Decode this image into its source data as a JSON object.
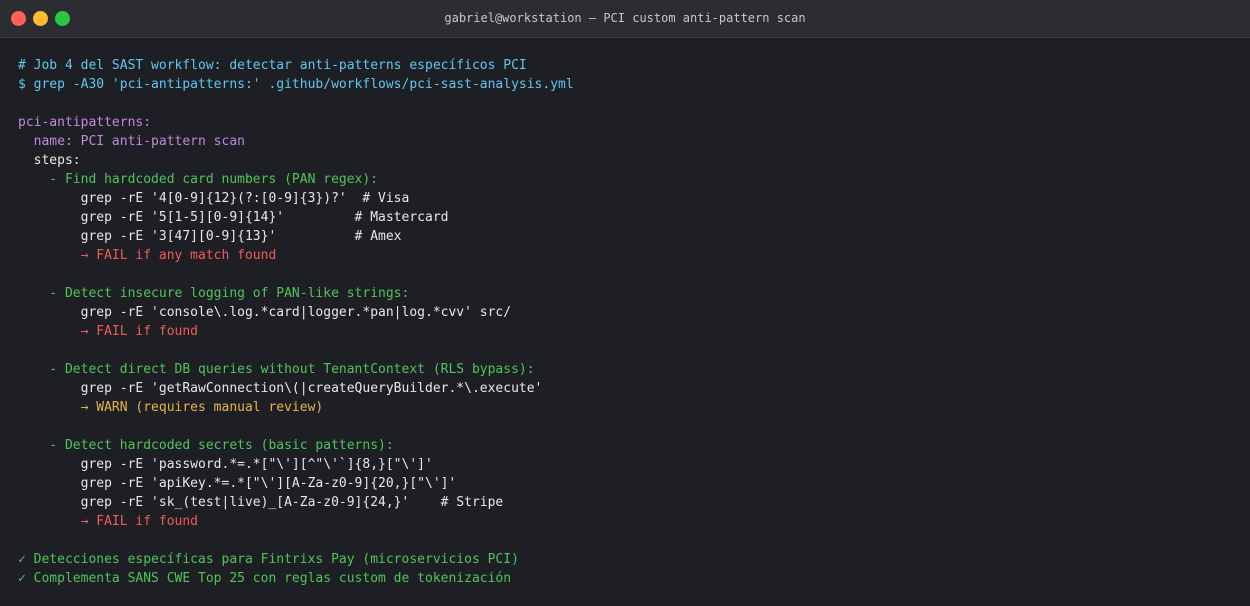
{
  "window": {
    "title": "gabriel@workstation — PCI custom anti-pattern scan"
  },
  "terminal": {
    "lines": [
      {
        "text": "# Job 4 del SAST workflow: detectar anti-patterns específicos PCI",
        "style": "comment"
      },
      {
        "text": "$ grep -A30 'pci-antipatterns:' .github/workflows/pci-sast-analysis.yml",
        "style": "command"
      },
      {
        "text": "",
        "style": "white"
      },
      {
        "text": "pci-antipatterns:",
        "style": "key"
      },
      {
        "text": "  name: PCI anti-pattern scan",
        "style": "key"
      },
      {
        "text": "  steps:",
        "style": "white"
      },
      {
        "text": "    - Find hardcoded card numbers (PAN regex):",
        "style": "step"
      },
      {
        "text": "        grep -rE '4[0-9]{12}(?:[0-9]{3})?'  # Visa",
        "style": "white"
      },
      {
        "text": "        grep -rE '5[1-5][0-9]{14}'         # Mastercard",
        "style": "white"
      },
      {
        "text": "        grep -rE '3[47][0-9]{13}'          # Amex",
        "style": "white"
      },
      {
        "text": "        → FAIL if any match found",
        "style": "fail"
      },
      {
        "text": "",
        "style": "white"
      },
      {
        "text": "    - Detect insecure logging of PAN-like strings:",
        "style": "step"
      },
      {
        "text": "        grep -rE 'console\\.log.*card|logger.*pan|log.*cvv' src/",
        "style": "white"
      },
      {
        "text": "        → FAIL if found",
        "style": "fail"
      },
      {
        "text": "",
        "style": "white"
      },
      {
        "text": "    - Detect direct DB queries without TenantContext (RLS bypass):",
        "style": "step"
      },
      {
        "text": "        grep -rE 'getRawConnection\\(|createQueryBuilder.*\\.execute'",
        "style": "white"
      },
      {
        "text": "        → WARN (requires manual review)",
        "style": "warn"
      },
      {
        "text": "",
        "style": "white"
      },
      {
        "text": "    - Detect hardcoded secrets (basic patterns):",
        "style": "step"
      },
      {
        "text": "        grep -rE 'password.*=.*[\"\\'][^\"\\'`]{8,}[\"\\']'",
        "style": "white"
      },
      {
        "text": "        grep -rE 'apiKey.*=.*[\"\\'][A-Za-z0-9]{20,}[\"\\']'",
        "style": "white"
      },
      {
        "text": "        grep -rE 'sk_(test|live)_[A-Za-z0-9]{24,}'    # Stripe",
        "style": "white"
      },
      {
        "text": "        → FAIL if found",
        "style": "fail"
      },
      {
        "text": "",
        "style": "white"
      },
      {
        "text": "✓ Detecciones específicas para Fintrixs Pay (microservicios PCI)",
        "style": "check"
      },
      {
        "text": "✓ Complementa SANS CWE Top 25 con reglas custom de tokenización",
        "style": "check"
      }
    ]
  },
  "colors": {
    "comment": "#5fc8f0",
    "key": "#c586e0",
    "step": "#4fc45a",
    "fail": "#f25a5a",
    "warn": "#e8b34a"
  }
}
